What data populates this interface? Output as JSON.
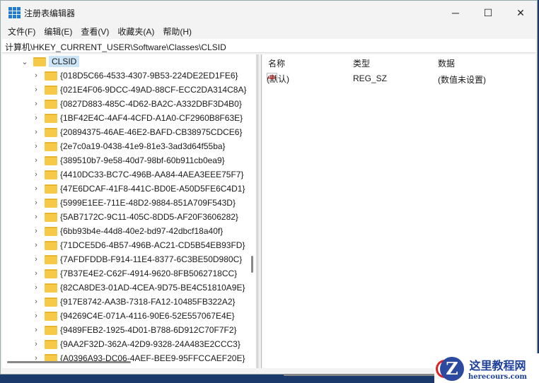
{
  "window": {
    "title": "注册表编辑器",
    "minimize": "─",
    "maximize": "☐",
    "close": "✕"
  },
  "menu": [
    "文件(F)",
    "编辑(E)",
    "查看(V)",
    "收藏夹(A)",
    "帮助(H)"
  ],
  "address": "计算机\\HKEY_CURRENT_USER\\Software\\Classes\\CLSID",
  "tree": {
    "selected": "CLSID",
    "children": [
      "{018D5C66-4533-4307-9B53-224DE2ED1FE6}",
      "{021E4F06-9DCC-49AD-88CF-ECC2DA314C8A}",
      "{0827D883-485C-4D62-BA2C-A332DBF3D4B0}",
      "{1BF42E4C-4AF4-4CFD-A1A0-CF2960B8F63E}",
      "{20894375-46AE-46E2-BAFD-CB38975CDCE6}",
      "{2e7c0a19-0438-41e9-81e3-3ad3d64f55ba}",
      "{389510b7-9e58-40d7-98bf-60b911cb0ea9}",
      "{4410DC33-BC7C-496B-AA84-4AEA3EEE75F7}",
      "{47E6DCAF-41F8-441C-BD0E-A50D5FE6C4D1}",
      "{5999E1EE-711E-48D2-9884-851A709F543D}",
      "{5AB7172C-9C11-405C-8DD5-AF20F3606282}",
      "{6bb93b4e-44d8-40e2-bd97-42dbcf18a40f}",
      "{71DCE5D6-4B57-496B-AC21-CD5B54EB93FD}",
      "{7AFDFDDB-F914-11E4-8377-6C3BE50D980C}",
      "{7B37E4E2-C62F-4914-9620-8FB5062718CC}",
      "{82CA8DE3-01AD-4CEA-9D75-BE4C51810A9E}",
      "{917E8742-AA3B-7318-FA12-10485FB322A2}",
      "{94269C4E-071A-4116-90E6-52E557067E4E}",
      "{9489FEB2-1925-4D01-B788-6D912C70F7F2}",
      "{9AA2F32D-362A-42D9-9328-24A483E2CCC3}",
      "{A0396A93-DC06-4AEF-BEE9-95FFCCAEF20E}"
    ]
  },
  "values": {
    "headers": {
      "name": "名称",
      "type": "类型",
      "data": "数据"
    },
    "rows": [
      {
        "icon": "ab",
        "name": "(默认)",
        "type": "REG_SZ",
        "data": "(数值未设置)"
      }
    ]
  },
  "watermark": {
    "title": "这里教程网",
    "url": "herecours.com",
    "logo_letter": "Z"
  }
}
